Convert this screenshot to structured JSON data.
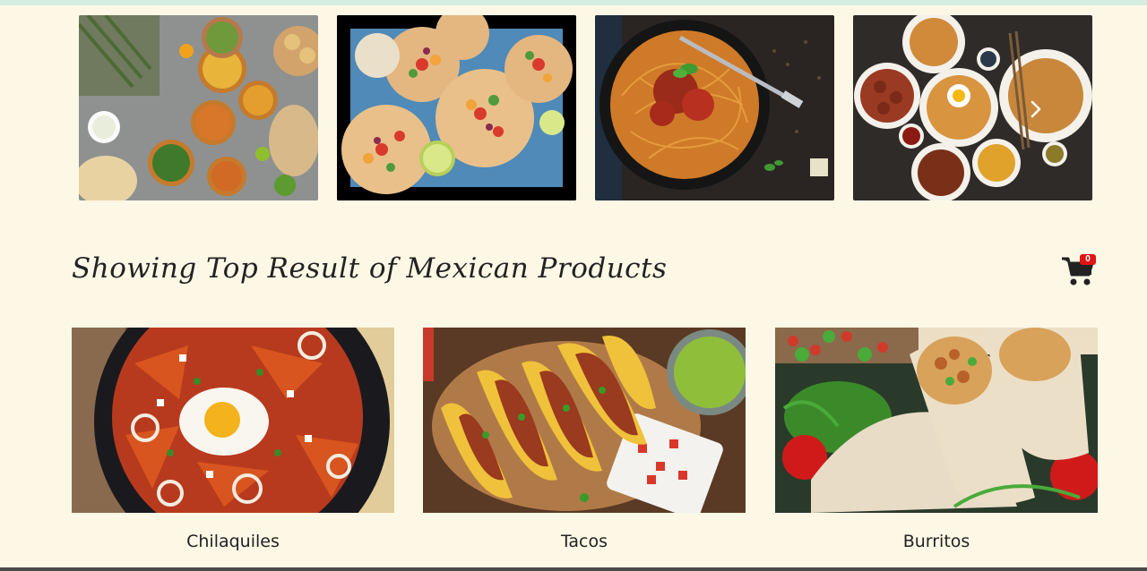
{
  "carousel": {
    "slides": [
      {
        "alt": "Indian dishes spread"
      },
      {
        "alt": "Tostadas with salsa"
      },
      {
        "alt": "Spaghetti with tomato sauce"
      },
      {
        "alt": "Asian noodle dishes"
      }
    ],
    "next_icon": "chevron-right-icon"
  },
  "heading": "Showing Top Result of Mexican Products",
  "cart": {
    "icon": "shopping-cart-icon",
    "count": "0",
    "badge_color": "#e01414"
  },
  "products": [
    {
      "name": "Chilaquiles"
    },
    {
      "name": "Tacos"
    },
    {
      "name": "Burritos"
    }
  ],
  "colors": {
    "background": "#fdf8e6",
    "top_strip": "#d6ede2",
    "text": "#222222"
  }
}
